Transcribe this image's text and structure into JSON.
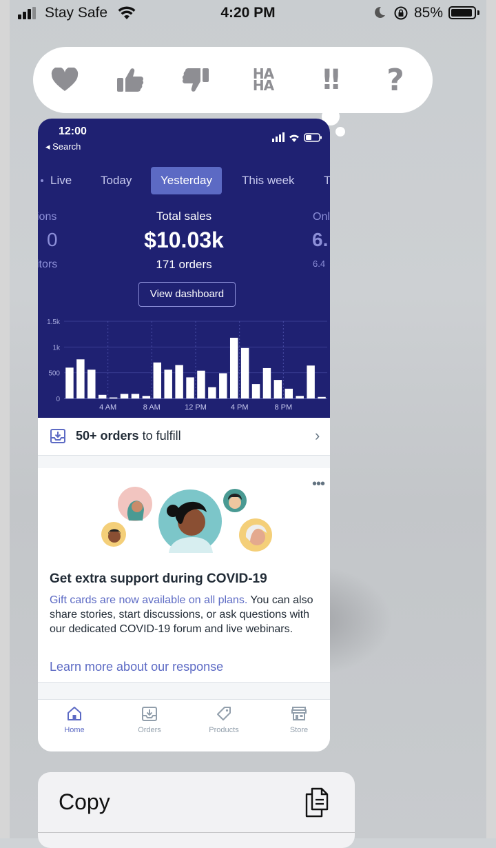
{
  "status_bar": {
    "carrier": "Stay Safe",
    "time": "4:20 PM",
    "battery_percent": "85%"
  },
  "reactions": [
    "heart",
    "thumbs-up",
    "thumbs-down",
    "haha",
    "exclamation",
    "question"
  ],
  "reaction_labels": {
    "haha_top": "HA",
    "haha_bottom": "HA",
    "exclamation": "!!",
    "question": "?"
  },
  "message_screenshot": {
    "status_bar": {
      "time": "12:00",
      "back_label": "◂ Search"
    },
    "tabs": [
      {
        "label": "Live",
        "active": false
      },
      {
        "label": "Today",
        "active": false
      },
      {
        "label": "Yesterday",
        "active": true
      },
      {
        "label": "This week",
        "active": false
      },
      {
        "label": "T",
        "active": false
      }
    ],
    "left_metric": {
      "label": "ions",
      "value": "0",
      "sublabel": "itors"
    },
    "center_metric": {
      "label": "Total sales",
      "value": "$10.03k",
      "sublabel": "171 orders"
    },
    "right_metric": {
      "label": "Onl",
      "value": "6.",
      "sublabel": "6.4"
    },
    "view_dashboard_label": "View dashboard",
    "fulfill": {
      "bold": "50+ orders",
      "rest": " to fulfill",
      "chevron": "›"
    },
    "covid_card": {
      "more": "•••",
      "title": "Get extra support during COVID-19",
      "link_text": "Gift cards are now available on all plans.",
      "body": " You can also share stories, start discussions, or ask questions with our dedicated COVID-19 forum and live webinars.",
      "cta": "Learn more about our response"
    },
    "bottom_nav": [
      {
        "label": "Home",
        "icon": "home-icon",
        "active": true
      },
      {
        "label": "Orders",
        "icon": "orders-icon",
        "active": false
      },
      {
        "label": "Products",
        "icon": "tag-icon",
        "active": false
      },
      {
        "label": "Store",
        "icon": "store-icon",
        "active": false
      }
    ]
  },
  "context_menu": {
    "copy_label": "Copy",
    "icon": "copy-icon"
  },
  "colors": {
    "navy": "#1f2172",
    "accent": "#5c6ac4",
    "reaction_gray": "#8e8e93"
  },
  "chart_data": {
    "type": "bar",
    "title": "",
    "xlabel": "",
    "ylabel": "",
    "ylim": [
      0,
      1500
    ],
    "y_ticks": [
      "0",
      "500",
      "1k",
      "1.5k"
    ],
    "y_tick_values": [
      0,
      500,
      1000,
      1500
    ],
    "x_tick_labels": [
      "4 AM",
      "8 AM",
      "12 PM",
      "4 PM",
      "8 PM"
    ],
    "x_tick_hours": [
      4,
      8,
      12,
      16,
      20
    ],
    "categories": [
      "0",
      "1",
      "2",
      "3",
      "4",
      "5",
      "6",
      "7",
      "8",
      "9",
      "10",
      "11",
      "12",
      "13",
      "14",
      "15",
      "16",
      "17",
      "18",
      "19",
      "20",
      "21",
      "22",
      "23"
    ],
    "values": [
      600,
      760,
      560,
      70,
      20,
      90,
      90,
      50,
      700,
      560,
      650,
      410,
      540,
      220,
      490,
      1180,
      980,
      280,
      590,
      360,
      190,
      50,
      640,
      30
    ]
  }
}
